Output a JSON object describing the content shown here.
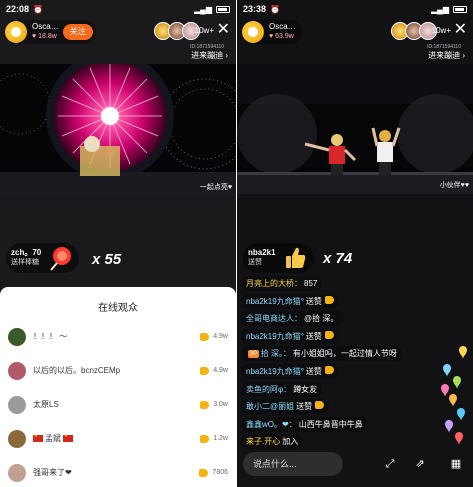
{
  "left": {
    "status": {
      "time": "22:08"
    },
    "host": {
      "name": "Osca…",
      "likes": "18.8w",
      "follow_label": "关注"
    },
    "viewer_count": "10w+",
    "room_id": "ID:1871594110",
    "enter_room": "进来蹦迪 ›",
    "video_caption": "一起点亮♥",
    "gift": {
      "user": "zch。70",
      "action": "送样棒糖",
      "combo": "x 55"
    },
    "audience": {
      "title": "在线观众",
      "rows": [
        {
          "name": "！！！ 〜",
          "value": "4.9w",
          "avatar_color": "#3a5a2a"
        },
        {
          "name": "以后的以后。bcnzCEMp",
          "value": "4.9w",
          "avatar_color": "#b05a6a"
        },
        {
          "name": "太原LS",
          "value": "3.0w",
          "avatar_color": "#9a9a9a"
        },
        {
          "name": "孟斌",
          "value": "1.2w",
          "avatar_color": "#8a6a3a"
        },
        {
          "name": "强哥来了❤",
          "value": "7806",
          "avatar_color": "#c0a090"
        }
      ]
    }
  },
  "right": {
    "status": {
      "time": "23:38"
    },
    "host": {
      "name": "Osca…",
      "likes": "63.9w"
    },
    "viewer_count": "10w+",
    "room_id": "ID:1871594110",
    "enter_room": "进来蹦迪 ›",
    "video_caption": "小伙伴♥♥",
    "gift": {
      "user": "nba2k1",
      "action": "送赞",
      "combo": "x 74"
    },
    "chat": [
      {
        "user": "月亮上的大桥：",
        "text": "857"
      },
      {
        "user": "nba2k19九命猫°",
        "text": "送赞",
        "thumb": true
      },
      {
        "user": "全哥电商达人：",
        "text": "@拾 深。"
      },
      {
        "user": "nba2k19九命猫°",
        "text": "送赞",
        "thumb": true
      },
      {
        "user": "拾 深。：",
        "text": "有小姐姐吗，一起过情人节呀",
        "badge": "90"
      },
      {
        "user": "nba2k19九命猫°",
        "text": "送赞",
        "thumb": true
      },
      {
        "user": "卖鱼的阿φ：",
        "text": "蹲女友"
      },
      {
        "user": "敢小二@丽姐",
        "text": "送赞",
        "thumb": true
      },
      {
        "user": "鑫鑫wO。❤：",
        "text": "山西牛鼻晋中牛鼻"
      },
      {
        "user": "来子.开心",
        "text": "加入"
      }
    ],
    "input_placeholder": "说点什么..."
  },
  "colors": {
    "follow": "#f56a1c",
    "thumb": "#f5b312",
    "chat_user": "#8ddcff"
  }
}
